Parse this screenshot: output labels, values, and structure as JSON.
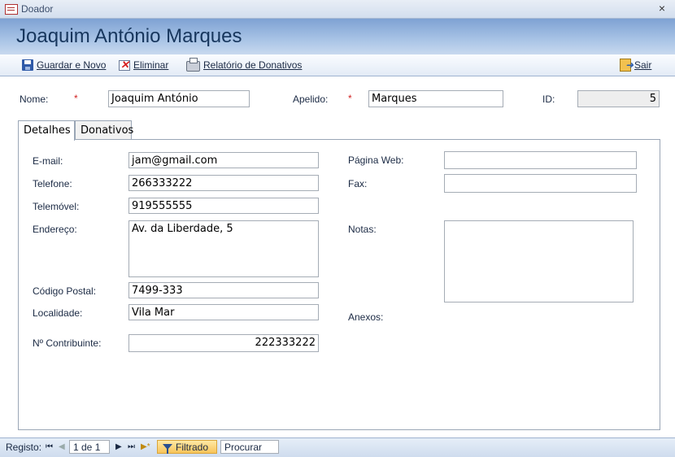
{
  "window": {
    "title": "Doador"
  },
  "header": {
    "title": "Joaquim António Marques"
  },
  "toolbar": {
    "save_new": "Guardar e Novo",
    "delete": "Eliminar",
    "report": "Relatório de Donativos",
    "exit": "Sair"
  },
  "record": {
    "nome_label": "Nome:",
    "nome_value": "Joaquim António",
    "apelido_label": "Apelido:",
    "apelido_value": "Marques",
    "id_label": "ID:",
    "id_value": "5",
    "required_mark": "*"
  },
  "tabs": [
    {
      "label": "Detalhes",
      "active": true
    },
    {
      "label": "Donativos",
      "active": false
    }
  ],
  "details": {
    "email_label": "E-mail:",
    "email_value": "jam@gmail.com",
    "telefone_label": "Telefone:",
    "telefone_value": "266333222",
    "telemovel_label": "Telemóvel:",
    "telemovel_value": "919555555",
    "endereco_label": "Endereço:",
    "endereco_value": "Av. da Liberdade, 5",
    "codigo_label": "Código Postal:",
    "codigo_value": "7499-333",
    "localidade_label": "Localidade:",
    "localidade_value": "Vila Mar",
    "contribuinte_label": "Nº Contribuinte:",
    "contribuinte_value": "222333222",
    "pagina_label": "Página Web:",
    "pagina_value": "",
    "fax_label": "Fax:",
    "fax_value": "",
    "notas_label": "Notas:",
    "notas_value": "",
    "anexos_label": "Anexos:"
  },
  "statusbar": {
    "registo_label": "Registo:",
    "position": "1 de 1",
    "filter_label": "Filtrado",
    "search_label": "Procurar"
  }
}
